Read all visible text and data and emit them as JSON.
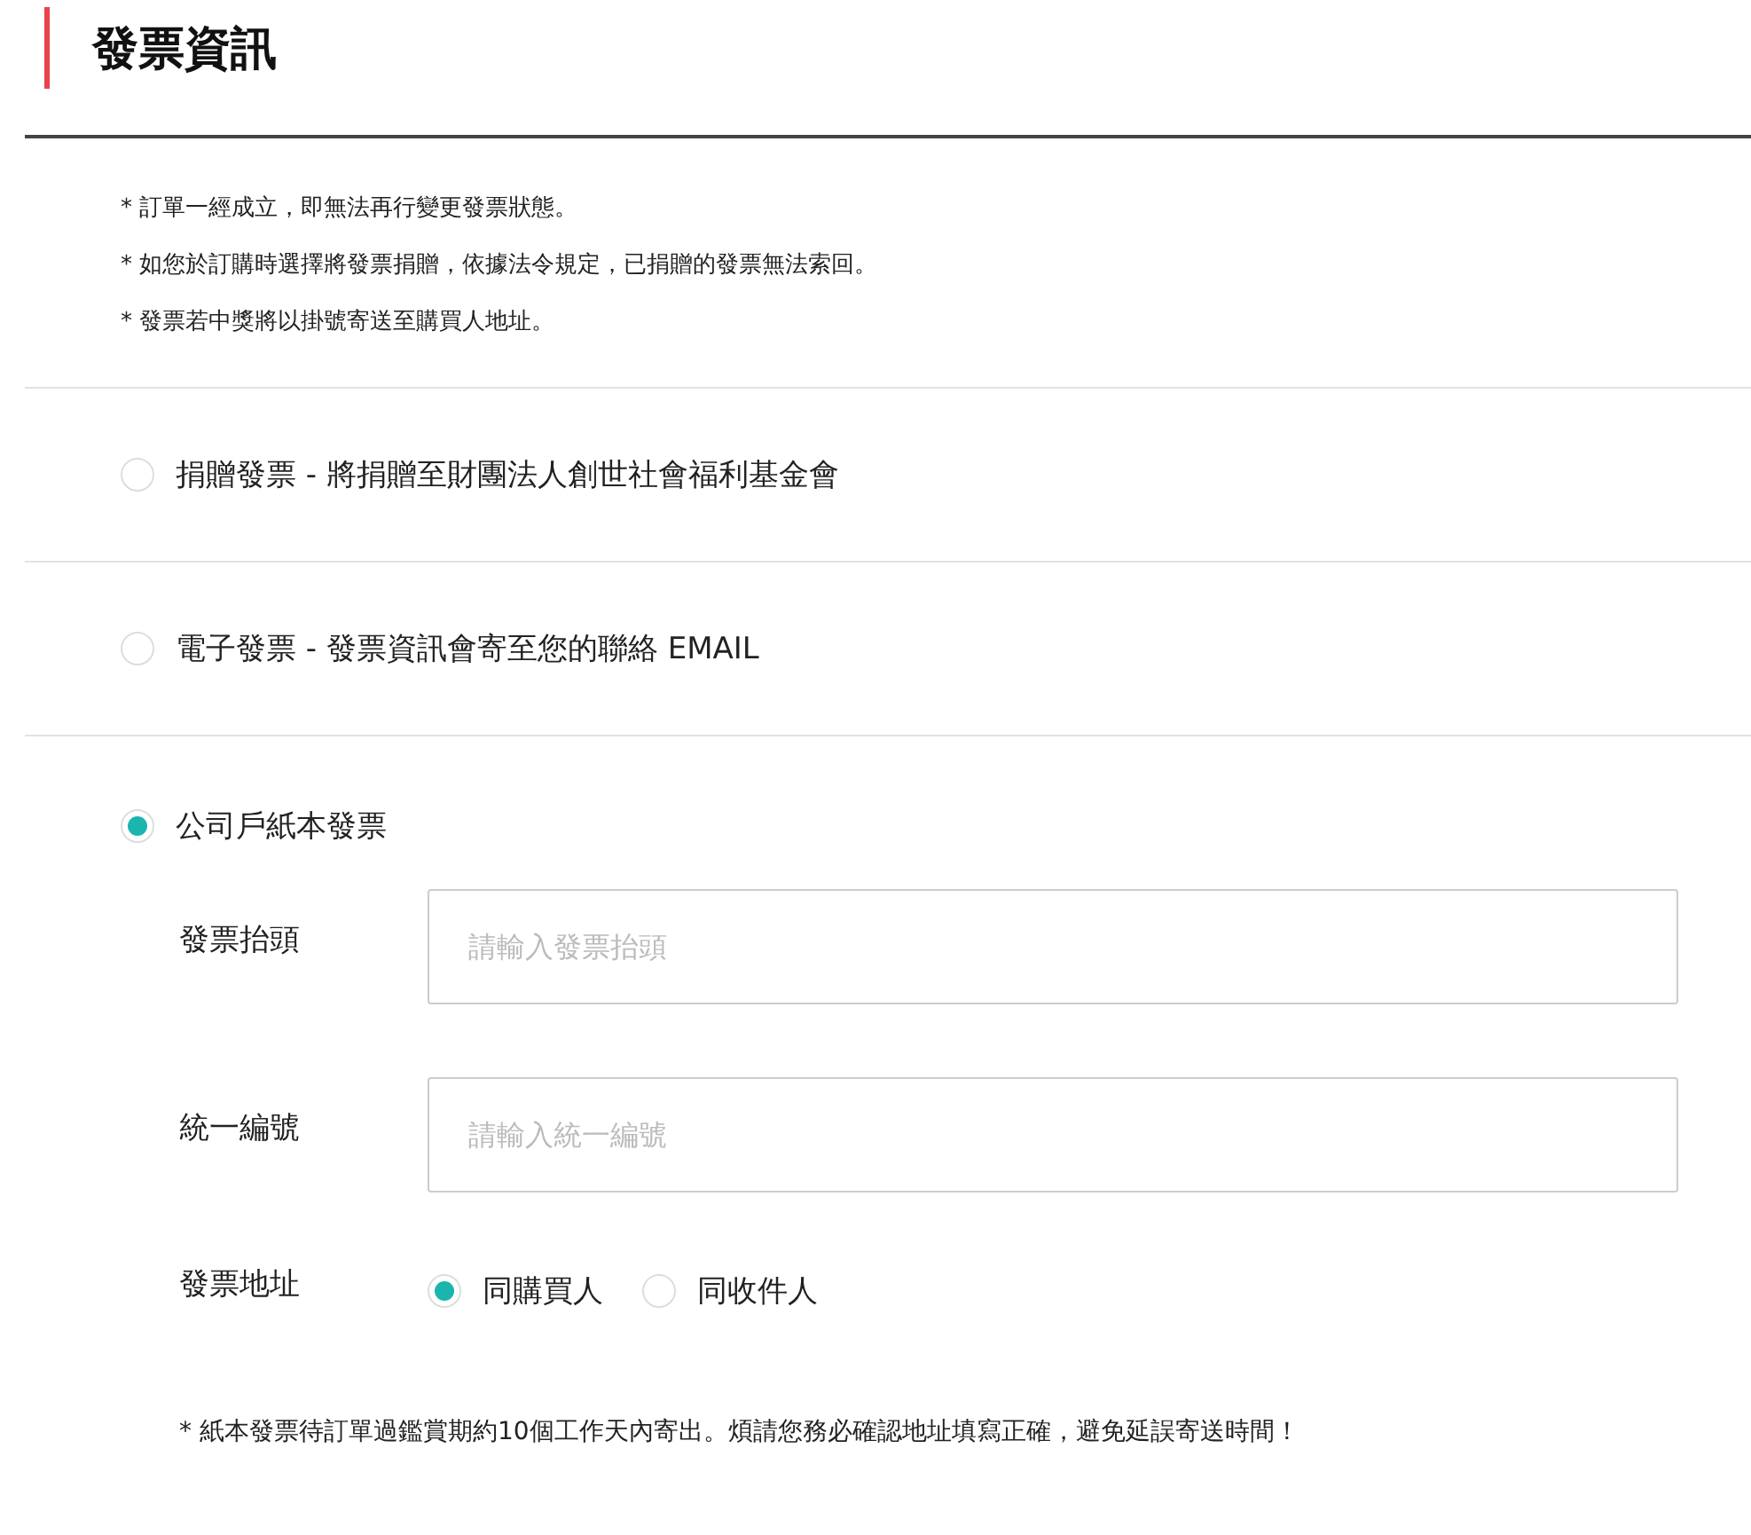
{
  "title": "發票資訊",
  "notes": [
    "* 訂單一經成立，即無法再行變更發票狀態。",
    "* 如您於訂購時選擇將發票捐贈，依據法令規定，已捐贈的發票無法索回。",
    "* 發票若中獎將以掛號寄送至購買人地址。"
  ],
  "options": [
    {
      "label": "捐贈發票 - 將捐贈至財團法人創世社會福利基金會",
      "selected": false
    },
    {
      "label": "電子發票 - 發票資訊會寄至您的聯絡 EMAIL",
      "selected": false
    },
    {
      "label": "公司戶紙本發票",
      "selected": true
    }
  ],
  "fields": [
    {
      "label": "發票抬頭",
      "placeholder": "請輸入發票抬頭"
    },
    {
      "label": "統一編號",
      "placeholder": "請輸入統一編號"
    }
  ],
  "address": {
    "label": "發票地址",
    "options": [
      {
        "label": "同購買人",
        "selected": true
      },
      {
        "label": "同收件人",
        "selected": false
      }
    ]
  },
  "footnote": "* 紙本發票待訂單過鑑賞期約10個工作天內寄出。煩請您務必確認地址填寫正確，避免延誤寄送時間！"
}
